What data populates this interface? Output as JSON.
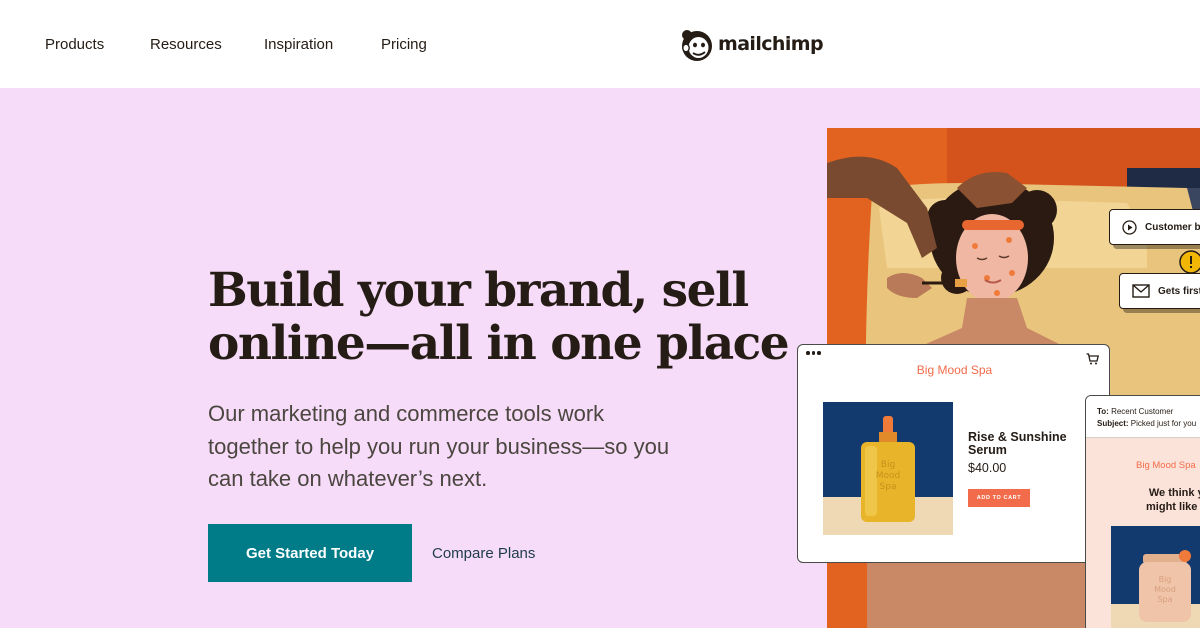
{
  "nav": {
    "items": [
      "Products",
      "Resources",
      "Inspiration",
      "Pricing"
    ],
    "logo_text": "mailchimp",
    "logo_icon": "freddie-chimp-logo"
  },
  "hero": {
    "headline_lines": [
      "Build your brand, sell",
      "online—all in one place"
    ],
    "subhead_lines": [
      "Our marketing and commerce tools work",
      "together to help you run your business—so you",
      "can take on whatever’s next."
    ],
    "cta_primary": "Get Started Today",
    "cta_secondary": "Compare Plans"
  },
  "chips": [
    {
      "icon": "play-icon",
      "label": "Customer b"
    },
    {
      "icon": "email-icon",
      "label": "Gets first"
    }
  ],
  "store_card": {
    "brand": "Big Mood Spa",
    "product_name": "Rise & Sunshine Serum",
    "price": "$40.00",
    "add_to_cart": "ADD TO CART",
    "bottle_label": [
      "Big",
      "Mood",
      "Spa"
    ]
  },
  "email_card": {
    "to_label": "To:",
    "to_value": "Recent Customer",
    "subject_label": "Subject:",
    "subject_value": "Picked just for you",
    "brand": "Big Mood Spa",
    "title_lines": [
      "We think you",
      "might like this"
    ],
    "jar_label": [
      "Big",
      "Mood",
      "Spa"
    ]
  },
  "colors": {
    "hero_bg": "#f6dcf8",
    "primary_button": "#007c89",
    "accent_coral": "#f26b4a",
    "text_dark": "#241c15",
    "link_blue": "#1e3b4c"
  }
}
